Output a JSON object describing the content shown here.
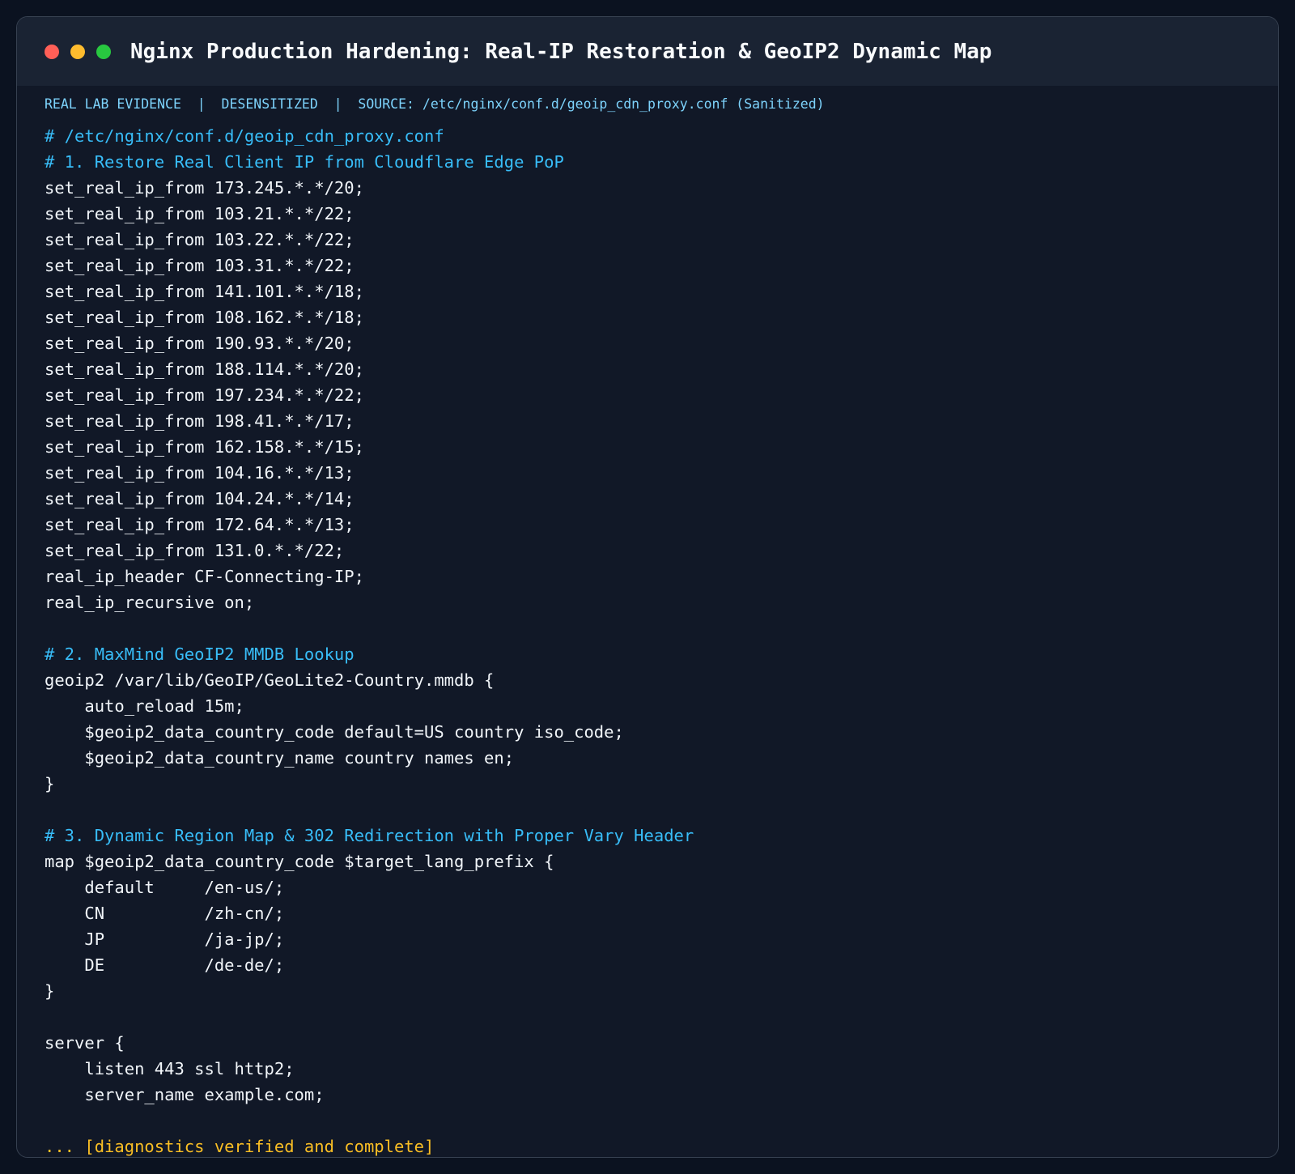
{
  "window": {
    "title": "Nginx Production Hardening: Real-IP Restoration & GeoIP2 Dynamic Map",
    "controls": [
      {
        "name": "close-dot",
        "color": "#ff5f57"
      },
      {
        "name": "minimize-dot",
        "color": "#febc2e"
      },
      {
        "name": "maximize-dot",
        "color": "#28c840"
      }
    ]
  },
  "meta": {
    "text": "REAL LAB EVIDENCE  |  DESENSITIZED  |  SOURCE: /etc/nginx/conf.d/geoip_cdn_proxy.conf (Sanitized)",
    "color": "#7dd3fc"
  },
  "colors": {
    "code": "#f1f5f9",
    "comment": "#38bdf8",
    "status": "#fbbf24",
    "background": "#111827",
    "titlebar": "#1a2333"
  },
  "code_lines": [
    {
      "text": "# /etc/nginx/conf.d/geoip_cdn_proxy.conf",
      "kind": "comment"
    },
    {
      "text": "# 1. Restore Real Client IP from Cloudflare Edge PoP",
      "kind": "comment"
    },
    {
      "text": "set_real_ip_from 173.245.*.*/20;",
      "kind": "code"
    },
    {
      "text": "set_real_ip_from 103.21.*.*/22;",
      "kind": "code"
    },
    {
      "text": "set_real_ip_from 103.22.*.*/22;",
      "kind": "code"
    },
    {
      "text": "set_real_ip_from 103.31.*.*/22;",
      "kind": "code"
    },
    {
      "text": "set_real_ip_from 141.101.*.*/18;",
      "kind": "code"
    },
    {
      "text": "set_real_ip_from 108.162.*.*/18;",
      "kind": "code"
    },
    {
      "text": "set_real_ip_from 190.93.*.*/20;",
      "kind": "code"
    },
    {
      "text": "set_real_ip_from 188.114.*.*/20;",
      "kind": "code"
    },
    {
      "text": "set_real_ip_from 197.234.*.*/22;",
      "kind": "code"
    },
    {
      "text": "set_real_ip_from 198.41.*.*/17;",
      "kind": "code"
    },
    {
      "text": "set_real_ip_from 162.158.*.*/15;",
      "kind": "code"
    },
    {
      "text": "set_real_ip_from 104.16.*.*/13;",
      "kind": "code"
    },
    {
      "text": "set_real_ip_from 104.24.*.*/14;",
      "kind": "code"
    },
    {
      "text": "set_real_ip_from 172.64.*.*/13;",
      "kind": "code"
    },
    {
      "text": "set_real_ip_from 131.0.*.*/22;",
      "kind": "code"
    },
    {
      "text": "real_ip_header CF-Connecting-IP;",
      "kind": "code"
    },
    {
      "text": "real_ip_recursive on;",
      "kind": "code"
    },
    {
      "text": "",
      "kind": "code"
    },
    {
      "text": "# 2. MaxMind GeoIP2 MMDB Lookup",
      "kind": "comment"
    },
    {
      "text": "geoip2 /var/lib/GeoIP/GeoLite2-Country.mmdb {",
      "kind": "code"
    },
    {
      "text": "    auto_reload 15m;",
      "kind": "code"
    },
    {
      "text": "    $geoip2_data_country_code default=US country iso_code;",
      "kind": "code"
    },
    {
      "text": "    $geoip2_data_country_name country names en;",
      "kind": "code"
    },
    {
      "text": "}",
      "kind": "code"
    },
    {
      "text": "",
      "kind": "code"
    },
    {
      "text": "# 3. Dynamic Region Map & 302 Redirection with Proper Vary Header",
      "kind": "comment"
    },
    {
      "text": "map $geoip2_data_country_code $target_lang_prefix {",
      "kind": "code"
    },
    {
      "text": "    default     /en-us/;",
      "kind": "code"
    },
    {
      "text": "    CN          /zh-cn/;",
      "kind": "code"
    },
    {
      "text": "    JP          /ja-jp/;",
      "kind": "code"
    },
    {
      "text": "    DE          /de-de/;",
      "kind": "code"
    },
    {
      "text": "}",
      "kind": "code"
    },
    {
      "text": "",
      "kind": "code"
    },
    {
      "text": "server {",
      "kind": "code"
    },
    {
      "text": "    listen 443 ssl http2;",
      "kind": "code"
    },
    {
      "text": "    server_name example.com;",
      "kind": "code"
    },
    {
      "text": "",
      "kind": "code"
    },
    {
      "text": "... [diagnostics verified and complete]",
      "kind": "status"
    }
  ]
}
